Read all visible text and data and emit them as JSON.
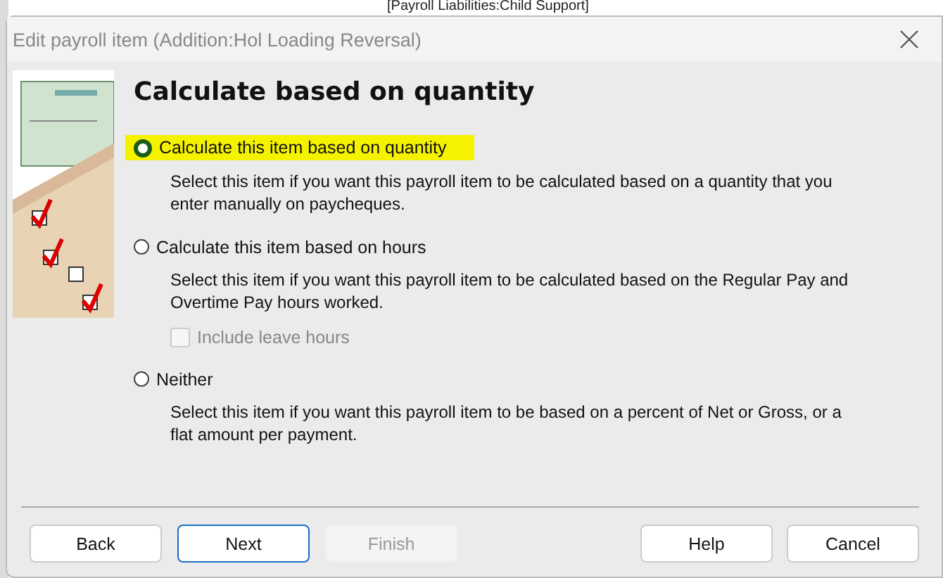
{
  "background_window": {
    "text": "[Payroll Liabilities:Child Support]"
  },
  "window": {
    "title": "Edit payroll item (Addition:Hol Loading Reversal)"
  },
  "heading": "Calculate based on quantity",
  "options": [
    {
      "label": "Calculate this item based on quantity",
      "selected": true,
      "highlighted": true,
      "description": "Select this item if you want this payroll item to be calculated based on a quantity that you enter manually on paycheques."
    },
    {
      "label": "Calculate this item based on hours",
      "selected": false,
      "highlighted": false,
      "description": "Select this item if you want this payroll item to be calculated based on the Regular Pay and Overtime Pay hours worked.",
      "checkbox": {
        "label": "Include leave hours",
        "checked": false,
        "disabled": true
      }
    },
    {
      "label": "Neither",
      "selected": false,
      "highlighted": false,
      "description": "Select this item if you want this payroll item to be based on a percent of Net or Gross, or a flat amount per payment."
    }
  ],
  "left_buttons": [
    {
      "label": "Back",
      "disabled": false,
      "focused": false
    },
    {
      "label": "Next",
      "disabled": false,
      "focused": true
    },
    {
      "label": "Finish",
      "disabled": true,
      "focused": false
    }
  ],
  "right_buttons": [
    {
      "label": "Help",
      "disabled": false,
      "focused": false
    },
    {
      "label": "Cancel",
      "disabled": false,
      "focused": false
    }
  ]
}
